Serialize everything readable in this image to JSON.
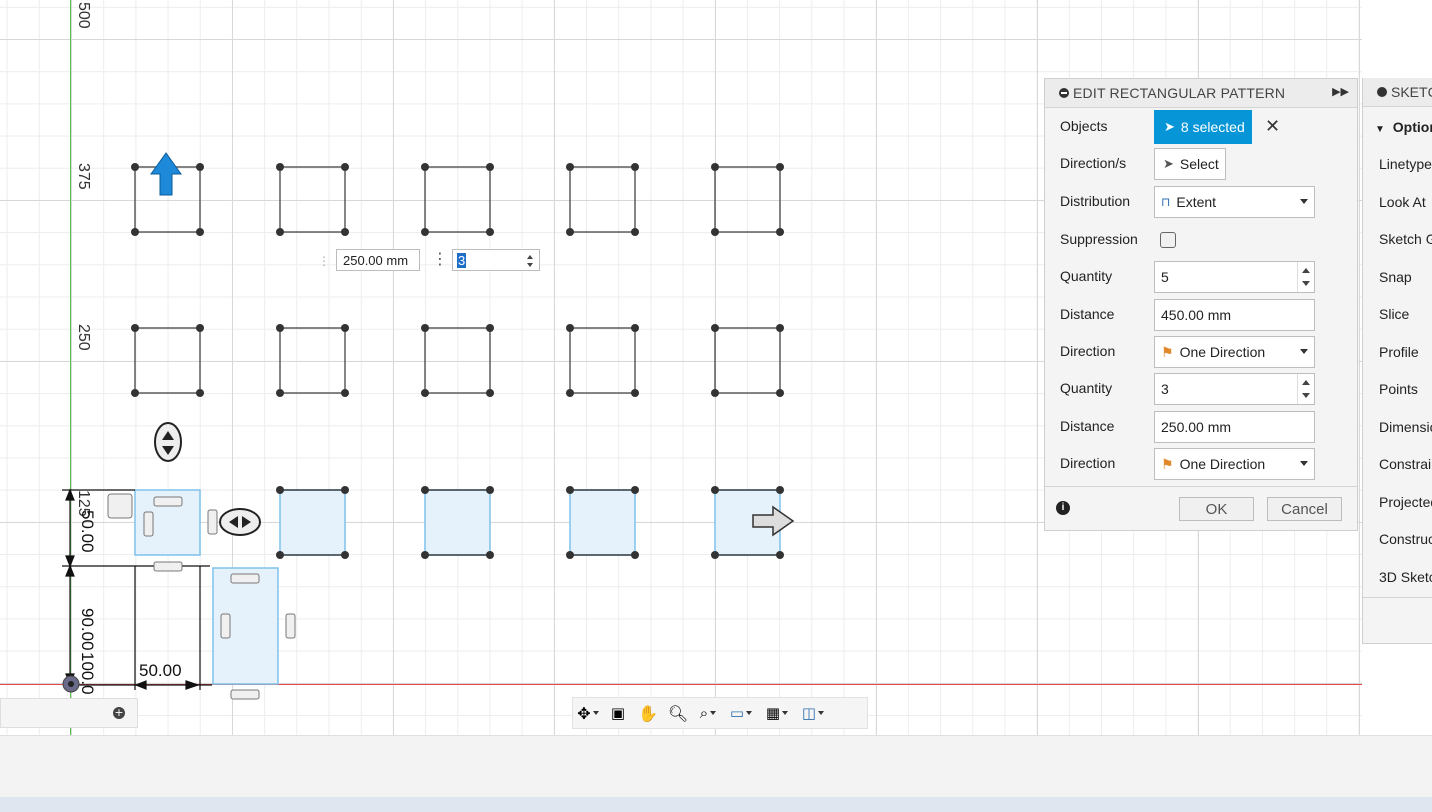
{
  "viewport": {
    "ruler_labels": [
      "500",
      "375",
      "250",
      "125"
    ],
    "dimensions": {
      "width_50": "50.00",
      "height_50": "50.00",
      "height_90": "90.00",
      "height_100": "100.0"
    },
    "inline_edit": {
      "distance_value": "250.00 mm",
      "quantity_value": "3"
    },
    "colors": {
      "y_axis": "#55c24a",
      "x_axis": "#e24a4a",
      "selection_fill": "#e6f2fb",
      "selection_stroke": "#7fc1ea"
    }
  },
  "panel": {
    "title": "EDIT RECTANGULAR PATTERN",
    "rows": {
      "objects_label": "Objects",
      "objects_value": "8 selected",
      "directions_label": "Direction/s",
      "directions_value": "Select",
      "distribution_label": "Distribution",
      "distribution_value": "Extent",
      "suppression_label": "Suppression",
      "quantity1_label": "Quantity",
      "quantity1_value": "5",
      "distance1_label": "Distance",
      "distance1_value": "450.00 mm",
      "direction1_label": "Direction",
      "direction1_value": "One Direction",
      "quantity2_label": "Quantity",
      "quantity2_value": "3",
      "distance2_label": "Distance",
      "distance2_value": "250.00 mm",
      "direction2_label": "Direction",
      "direction2_value": "One Direction"
    },
    "ok_label": "OK",
    "cancel_label": "Cancel",
    "accent": "#0696d7"
  },
  "sketch_palette": {
    "title": "SKETC",
    "section": "Option",
    "items": [
      "Linetype",
      "Look At",
      "Sketch G",
      "Snap",
      "Slice",
      "Profile",
      "Points",
      "Dimensio",
      "Constrain",
      "Projected",
      "Construc",
      "3D Sketc"
    ]
  },
  "nav_toolbar": {
    "tools": [
      "orbit-icon",
      "look-at-icon",
      "pan-icon",
      "zoom-icon",
      "zoom-window-icon",
      "display-settings-icon",
      "grid-icon",
      "viewports-icon"
    ]
  }
}
